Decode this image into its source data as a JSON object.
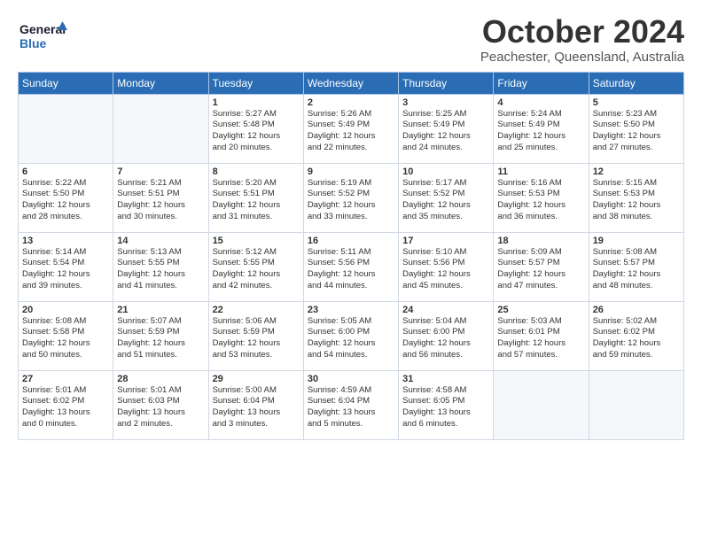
{
  "header": {
    "logo_line1": "General",
    "logo_line2": "Blue",
    "month": "October 2024",
    "location": "Peachester, Queensland, Australia"
  },
  "weekdays": [
    "Sunday",
    "Monday",
    "Tuesday",
    "Wednesday",
    "Thursday",
    "Friday",
    "Saturday"
  ],
  "weeks": [
    [
      {
        "day": "",
        "info": ""
      },
      {
        "day": "",
        "info": ""
      },
      {
        "day": "1",
        "info": "Sunrise: 5:27 AM\nSunset: 5:48 PM\nDaylight: 12 hours\nand 20 minutes."
      },
      {
        "day": "2",
        "info": "Sunrise: 5:26 AM\nSunset: 5:49 PM\nDaylight: 12 hours\nand 22 minutes."
      },
      {
        "day": "3",
        "info": "Sunrise: 5:25 AM\nSunset: 5:49 PM\nDaylight: 12 hours\nand 24 minutes."
      },
      {
        "day": "4",
        "info": "Sunrise: 5:24 AM\nSunset: 5:49 PM\nDaylight: 12 hours\nand 25 minutes."
      },
      {
        "day": "5",
        "info": "Sunrise: 5:23 AM\nSunset: 5:50 PM\nDaylight: 12 hours\nand 27 minutes."
      }
    ],
    [
      {
        "day": "6",
        "info": "Sunrise: 5:22 AM\nSunset: 5:50 PM\nDaylight: 12 hours\nand 28 minutes."
      },
      {
        "day": "7",
        "info": "Sunrise: 5:21 AM\nSunset: 5:51 PM\nDaylight: 12 hours\nand 30 minutes."
      },
      {
        "day": "8",
        "info": "Sunrise: 5:20 AM\nSunset: 5:51 PM\nDaylight: 12 hours\nand 31 minutes."
      },
      {
        "day": "9",
        "info": "Sunrise: 5:19 AM\nSunset: 5:52 PM\nDaylight: 12 hours\nand 33 minutes."
      },
      {
        "day": "10",
        "info": "Sunrise: 5:17 AM\nSunset: 5:52 PM\nDaylight: 12 hours\nand 35 minutes."
      },
      {
        "day": "11",
        "info": "Sunrise: 5:16 AM\nSunset: 5:53 PM\nDaylight: 12 hours\nand 36 minutes."
      },
      {
        "day": "12",
        "info": "Sunrise: 5:15 AM\nSunset: 5:53 PM\nDaylight: 12 hours\nand 38 minutes."
      }
    ],
    [
      {
        "day": "13",
        "info": "Sunrise: 5:14 AM\nSunset: 5:54 PM\nDaylight: 12 hours\nand 39 minutes."
      },
      {
        "day": "14",
        "info": "Sunrise: 5:13 AM\nSunset: 5:55 PM\nDaylight: 12 hours\nand 41 minutes."
      },
      {
        "day": "15",
        "info": "Sunrise: 5:12 AM\nSunset: 5:55 PM\nDaylight: 12 hours\nand 42 minutes."
      },
      {
        "day": "16",
        "info": "Sunrise: 5:11 AM\nSunset: 5:56 PM\nDaylight: 12 hours\nand 44 minutes."
      },
      {
        "day": "17",
        "info": "Sunrise: 5:10 AM\nSunset: 5:56 PM\nDaylight: 12 hours\nand 45 minutes."
      },
      {
        "day": "18",
        "info": "Sunrise: 5:09 AM\nSunset: 5:57 PM\nDaylight: 12 hours\nand 47 minutes."
      },
      {
        "day": "19",
        "info": "Sunrise: 5:08 AM\nSunset: 5:57 PM\nDaylight: 12 hours\nand 48 minutes."
      }
    ],
    [
      {
        "day": "20",
        "info": "Sunrise: 5:08 AM\nSunset: 5:58 PM\nDaylight: 12 hours\nand 50 minutes."
      },
      {
        "day": "21",
        "info": "Sunrise: 5:07 AM\nSunset: 5:59 PM\nDaylight: 12 hours\nand 51 minutes."
      },
      {
        "day": "22",
        "info": "Sunrise: 5:06 AM\nSunset: 5:59 PM\nDaylight: 12 hours\nand 53 minutes."
      },
      {
        "day": "23",
        "info": "Sunrise: 5:05 AM\nSunset: 6:00 PM\nDaylight: 12 hours\nand 54 minutes."
      },
      {
        "day": "24",
        "info": "Sunrise: 5:04 AM\nSunset: 6:00 PM\nDaylight: 12 hours\nand 56 minutes."
      },
      {
        "day": "25",
        "info": "Sunrise: 5:03 AM\nSunset: 6:01 PM\nDaylight: 12 hours\nand 57 minutes."
      },
      {
        "day": "26",
        "info": "Sunrise: 5:02 AM\nSunset: 6:02 PM\nDaylight: 12 hours\nand 59 minutes."
      }
    ],
    [
      {
        "day": "27",
        "info": "Sunrise: 5:01 AM\nSunset: 6:02 PM\nDaylight: 13 hours\nand 0 minutes."
      },
      {
        "day": "28",
        "info": "Sunrise: 5:01 AM\nSunset: 6:03 PM\nDaylight: 13 hours\nand 2 minutes."
      },
      {
        "day": "29",
        "info": "Sunrise: 5:00 AM\nSunset: 6:04 PM\nDaylight: 13 hours\nand 3 minutes."
      },
      {
        "day": "30",
        "info": "Sunrise: 4:59 AM\nSunset: 6:04 PM\nDaylight: 13 hours\nand 5 minutes."
      },
      {
        "day": "31",
        "info": "Sunrise: 4:58 AM\nSunset: 6:05 PM\nDaylight: 13 hours\nand 6 minutes."
      },
      {
        "day": "",
        "info": ""
      },
      {
        "day": "",
        "info": ""
      }
    ]
  ]
}
